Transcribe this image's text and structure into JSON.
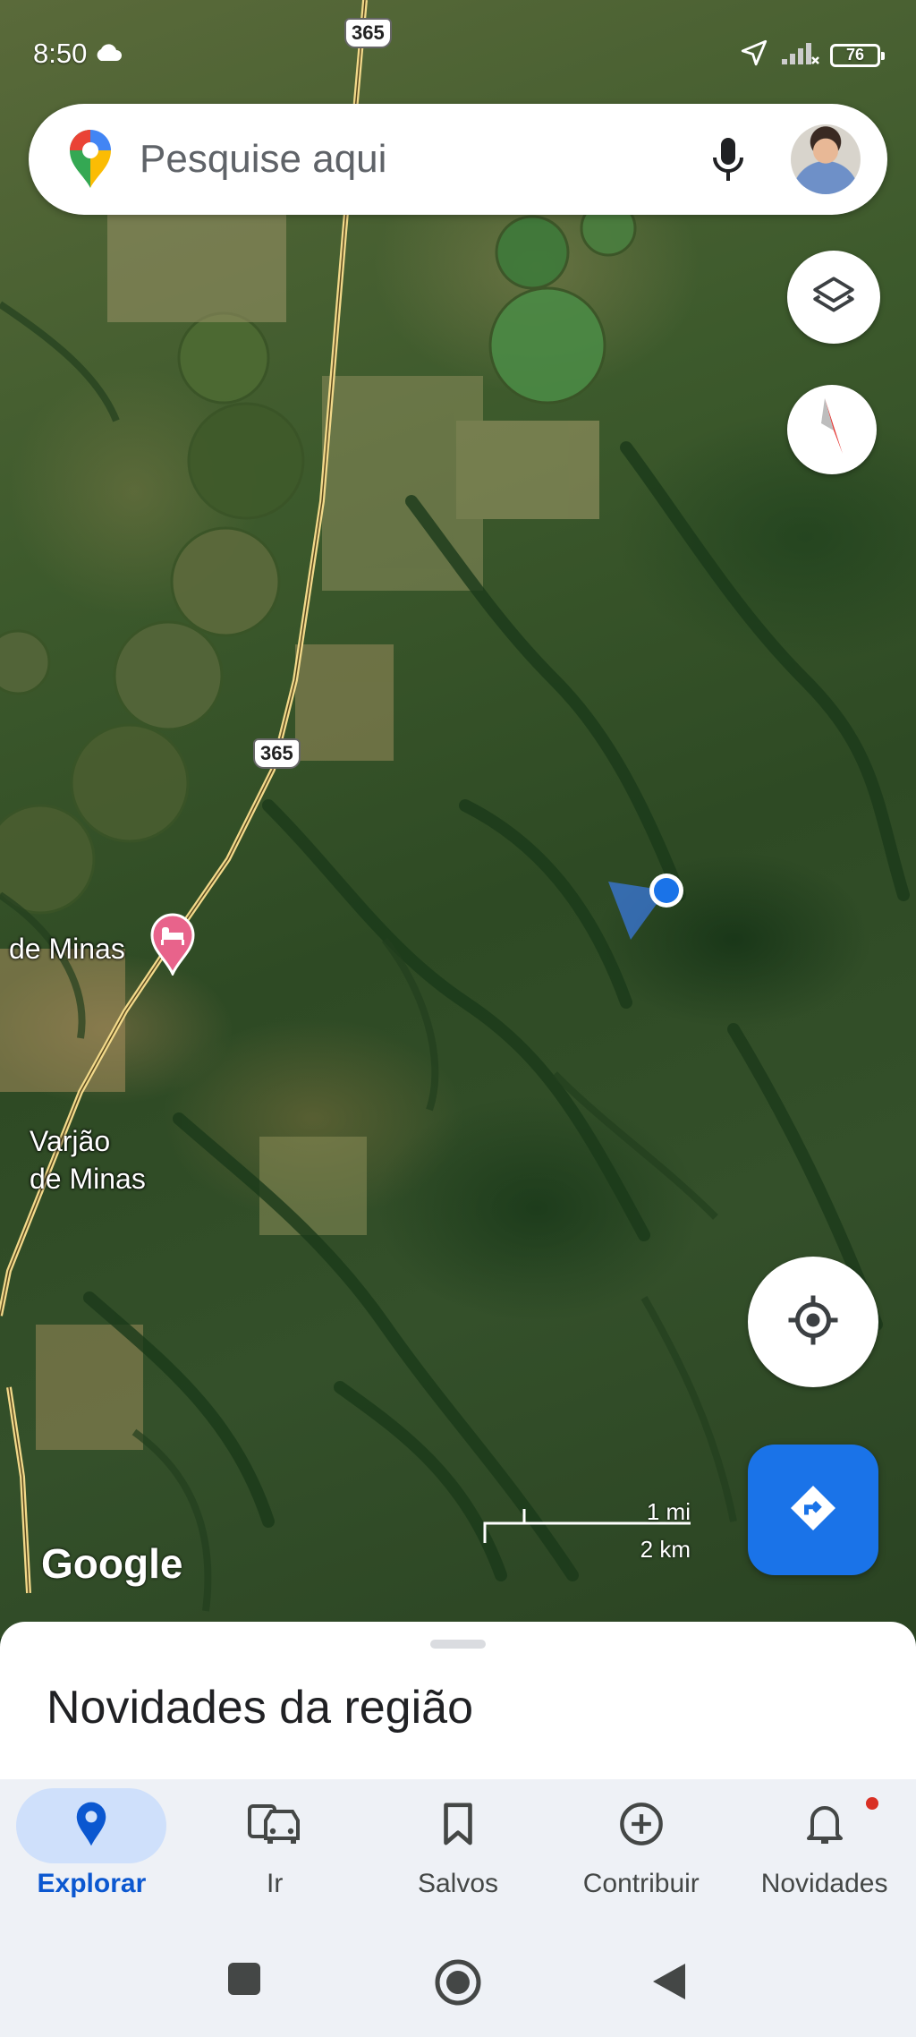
{
  "status_bar": {
    "time": "8:50",
    "battery": "76"
  },
  "search": {
    "placeholder": "Pesquise aqui"
  },
  "map": {
    "road_number_top": "365",
    "road_number_mid": "365",
    "place_label_1": "de Minas",
    "place_label_2_line1": "Varjão",
    "place_label_2_line2": "de Minas",
    "scale_imperial": "1 mi",
    "scale_metric": "2 km",
    "attribution": "Google"
  },
  "sheet": {
    "title": "Novidades da região"
  },
  "bottom_nav": {
    "items": [
      {
        "label": "Explorar"
      },
      {
        "label": "Ir"
      },
      {
        "label": "Salvos"
      },
      {
        "label": "Contribuir"
      },
      {
        "label": "Novidades"
      }
    ]
  },
  "colors": {
    "accent": "#1a73e8",
    "active_pill": "#cfe0fb",
    "hotel_pin": "#e8638b"
  },
  "icons": [
    "cloud-icon",
    "location-arrow-icon",
    "signal-icon",
    "battery-icon",
    "maps-pin-logo",
    "mic-icon",
    "layers-icon",
    "compass-icon",
    "my-location-icon",
    "directions-icon",
    "hotel-pin-icon",
    "explore-pin-icon",
    "car-icon",
    "bookmark-icon",
    "add-circle-icon",
    "bell-icon"
  ]
}
